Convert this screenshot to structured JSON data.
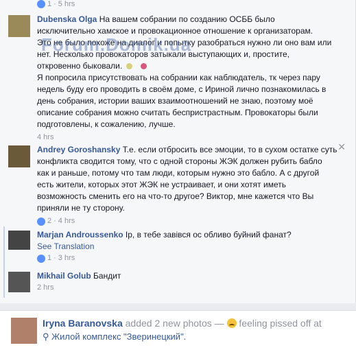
{
  "colors": {
    "link": "#365899",
    "meta": "#90949c",
    "like": "#5890ff"
  },
  "watermark": "Forum.Domik.ua",
  "top_meta": {
    "likes": "1",
    "time": "5 hrs"
  },
  "comments": [
    {
      "author": "Dubenska Olga",
      "text_lines": [
        "На вашем собрании по созданию ОСББ было",
        "исключительно хамское и провокационное отношение к организаторам.",
        "Это не было похоже на диалог и попытку разобраться нужно ли оно вам или",
        "нет. Несколько провокаторов затыкали выступающих и, простите,",
        "откровенно быковали."
      ],
      "text_lines_2": [
        "Я попросила присутствовать на собрании как наблюдатель, тк через пару",
        "недель буду его проводить в своём доме, с Ириной лично познакомилась в",
        "день собрания, истории ваших взаимоотношений не знаю, поэтому моё",
        "описание собрания можно считать беспристрастным. Провокаторы были",
        "подготовлены, к сожалению, лучше."
      ],
      "time": "4 hrs"
    },
    {
      "author": "Andrey Goroshansky",
      "text_lines": [
        "Т.е. если отбросить все эмоции, то в сухом остатке суть",
        "конфликта сводится тому, что с одной стороны ЖЭК должен рубить бабло",
        "как и раньше, потому что там люди, которым нужно это бабло. А с другой",
        "есть жители, которых этот ЖЭК не устраивает, и они хотят иметь",
        "возможность сменить его на что-то другое? Виктор, мне кажется что Вы",
        "приняли не ту сторону."
      ],
      "likes": "2",
      "time": "4 hrs"
    },
    {
      "author": "Marjan Androussenko",
      "text": "Ір, в тебе завівся ос обливо буйний фанат?",
      "see_translation": "See Translation",
      "likes": "1",
      "time": "3 hrs"
    },
    {
      "author": "Mikhail Golub",
      "text": "Бандит",
      "time": "2 hrs"
    }
  ],
  "post": {
    "author": "Iryna Baranovska",
    "action": "added 2 new photos —",
    "feeling": "feeling pissed off at",
    "place": "Жилой комплекс \"Зверинецкий\"."
  }
}
